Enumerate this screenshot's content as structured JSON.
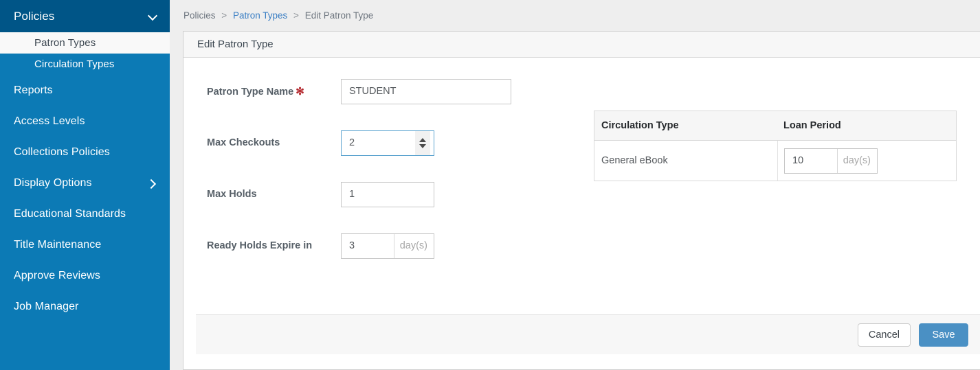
{
  "sidebar": {
    "header": {
      "label": "Policies",
      "icon": "chevron-down-icon"
    },
    "subitems": [
      {
        "label": "Patron Types",
        "active": true
      },
      {
        "label": "Circulation Types",
        "active": false
      }
    ],
    "items": [
      {
        "label": "Reports",
        "icon": ""
      },
      {
        "label": "Access Levels",
        "icon": ""
      },
      {
        "label": "Collections Policies",
        "icon": ""
      },
      {
        "label": "Display Options",
        "icon": "chevron-right-icon"
      },
      {
        "label": "Educational Standards",
        "icon": ""
      },
      {
        "label": "Title Maintenance",
        "icon": ""
      },
      {
        "label": "Approve Reviews",
        "icon": ""
      },
      {
        "label": "Job Manager",
        "icon": ""
      }
    ],
    "colors": {
      "header_bg": "#005587",
      "body_bg": "#0c7ab5",
      "active_bg": "#f9f9f9"
    }
  },
  "breadcrumb": {
    "items": [
      {
        "label": "Policies",
        "link": false
      },
      {
        "label": "Patron Types",
        "link": true
      },
      {
        "label": "Edit Patron Type",
        "link": false
      }
    ],
    "separator": ">"
  },
  "panel": {
    "title": "Edit Patron Type"
  },
  "form": {
    "fields": [
      {
        "label": "Patron Type Name",
        "required": true,
        "required_mark": "✻",
        "value": "STUDENT",
        "placeholder": "",
        "suffix": "",
        "spinner": false,
        "focused": false
      },
      {
        "label": "Max Checkouts",
        "required": false,
        "required_mark": "",
        "value": "2",
        "placeholder": "",
        "suffix": "",
        "spinner": true,
        "focused": true
      },
      {
        "label": "Max Holds",
        "required": false,
        "required_mark": "",
        "value": "1",
        "placeholder": "",
        "suffix": "",
        "spinner": false,
        "focused": false
      },
      {
        "label": "Ready Holds Expire in",
        "required": false,
        "required_mark": "",
        "value": "3",
        "placeholder": "",
        "suffix": "day(s)",
        "spinner": false,
        "focused": false
      }
    ]
  },
  "circulation_table": {
    "columns": [
      "Circulation Type",
      "Loan Period"
    ],
    "rows": [
      {
        "type": "General eBook",
        "loan_period": "10",
        "loan_suffix": "day(s)"
      }
    ]
  },
  "footer": {
    "cancel_label": "Cancel",
    "save_label": "Save",
    "save_color": "#4a90c4"
  }
}
